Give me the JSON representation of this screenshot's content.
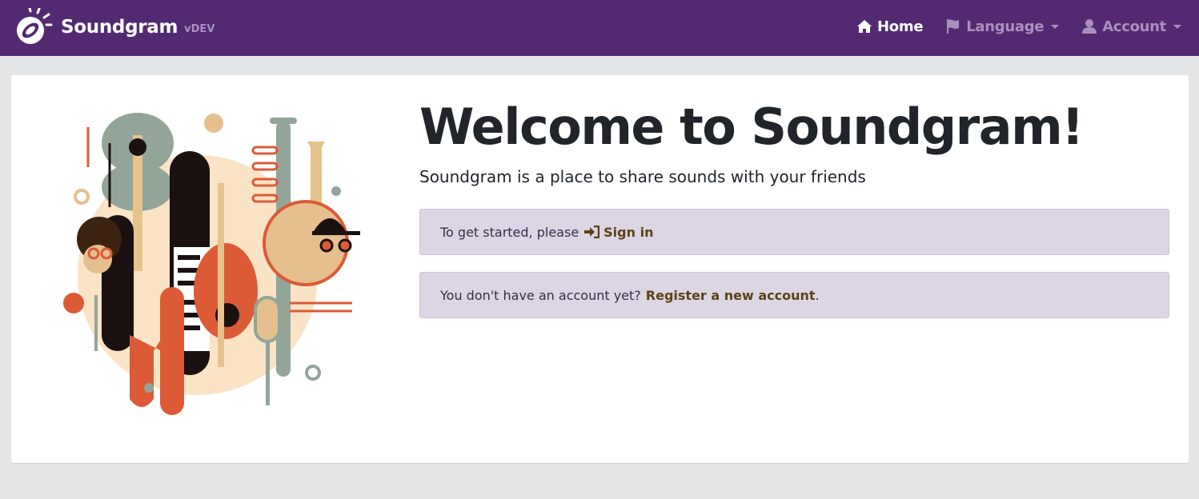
{
  "navbar": {
    "brand": "Soundgram",
    "version": "vDEV",
    "home": "Home",
    "language": "Language",
    "account": "Account",
    "icons": [
      "speaker-logo-icon",
      "home-icon",
      "flag-icon",
      "user-icon",
      "chevron-down-icon"
    ]
  },
  "main": {
    "title": "Welcome to Soundgram!",
    "lead": "Soundgram is a place to share sounds with your friends",
    "signin_prefix": "To get started, please",
    "signin_link": "Sign in",
    "register_prefix": "You don't have an account yet?",
    "register_link": "Register a new account",
    "register_suffix": "."
  },
  "colors": {
    "navbar": "#532a72",
    "muted_nav": "#a990bc",
    "alert_bg": "#dcd5e3",
    "link": "#5b4214",
    "page_bg": "#e5e6e8"
  }
}
